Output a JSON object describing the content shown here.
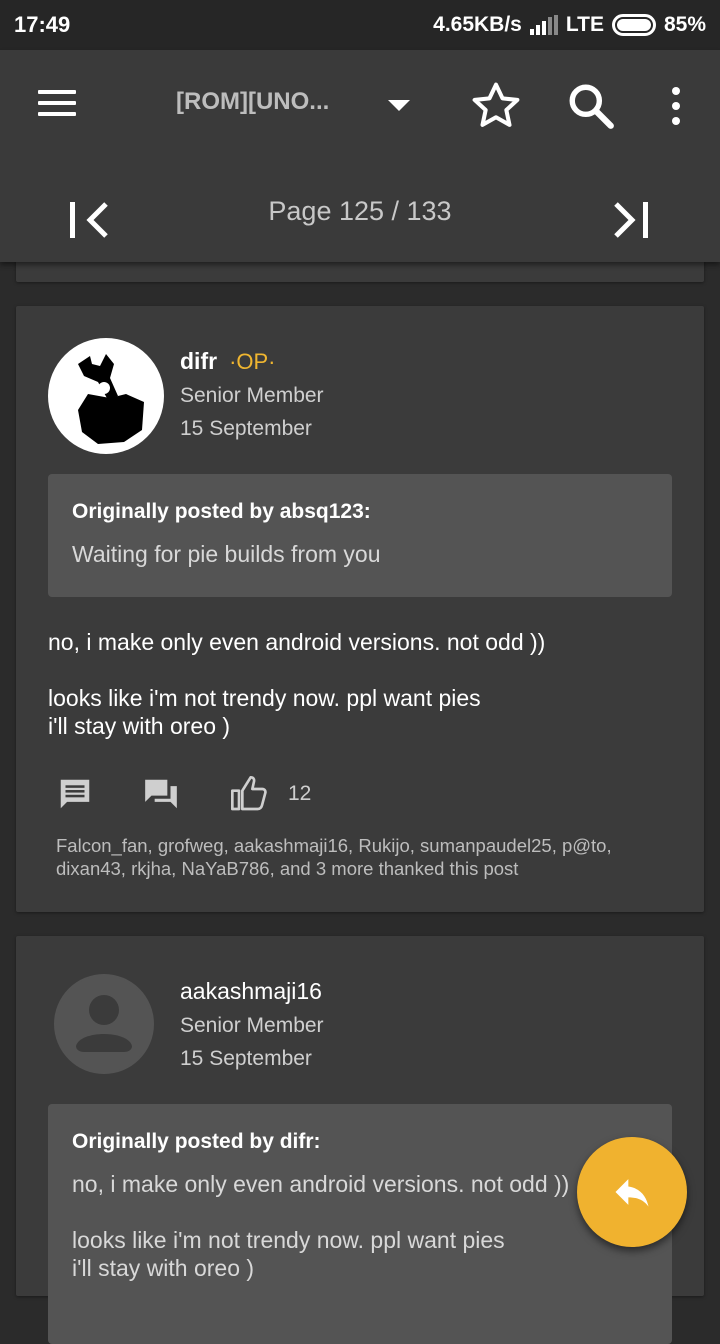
{
  "status": {
    "time": "17:49",
    "speed": "4.65KB/s",
    "network": "LTE",
    "battery": "85%"
  },
  "toolbar": {
    "title": "[ROM][UNO..."
  },
  "pager": {
    "label": "Page 125 / 133"
  },
  "posts": [
    {
      "username": "difr",
      "badge": "·OP·",
      "role": "Senior Member",
      "date": "15 September",
      "quote_header": "Originally posted by absq123:",
      "quote_text": "Waiting for pie builds from you",
      "body_line1": "no, i make only even android versions. not odd ))",
      "body_line2": "looks like i'm not trendy now. ppl want pies",
      "body_line3": "i'll stay with oreo )",
      "like_count": "12",
      "thanks_text": "Falcon_fan, grofweg, aakashmaji16, Rukijo, sumanpaudel25, p@to, dixan43, rkjha, NaYaB786, and 3 more thanked this post"
    },
    {
      "username": "aakashmaji16",
      "role": "Senior Member",
      "date": "15 September",
      "quote_header": "Originally posted by difr:",
      "quote_line1": "no, i make only even android versions. not odd ))",
      "quote_line2": "looks like i'm not trendy now. ppl want pies",
      "quote_line3": "i'll stay with oreo )"
    }
  ],
  "colors": {
    "accent": "#f0b22f",
    "op_badge": "#f0b630",
    "background": "#2b2b2b",
    "card": "#3b3b3b",
    "quote": "#545454"
  }
}
